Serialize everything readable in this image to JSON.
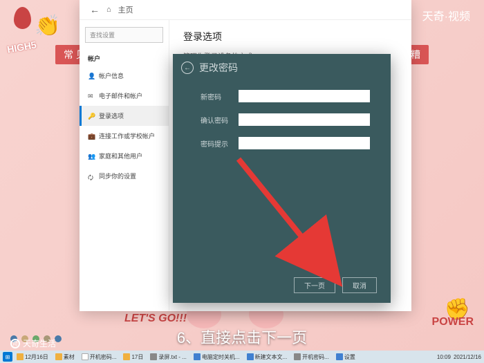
{
  "decorations": {
    "high5": "HIGH5",
    "tag1": "常 见",
    "tag2": "乱七八糟",
    "letsgo": "LET'S GO!!!",
    "power": "POWER"
  },
  "watermark": {
    "top_right": "天奇·视频",
    "bottom_left": "天奇生活"
  },
  "settings": {
    "header_home": "主页",
    "search_placeholder": "查找设置",
    "section": "帐户",
    "items": [
      {
        "label": "帐户信息"
      },
      {
        "label": "电子邮件和帐户"
      },
      {
        "label": "登录选项"
      },
      {
        "label": "连接工作或学校帐户"
      },
      {
        "label": "家庭和其他用户"
      },
      {
        "label": "同步你的设置"
      }
    ],
    "main_title": "登录选项",
    "main_sub": "管理你登录设备的方式"
  },
  "dialog": {
    "title": "更改密码",
    "fields": {
      "new_password": "新密码",
      "confirm_password": "确认密码",
      "hint": "密码提示"
    },
    "buttons": {
      "next": "下一页",
      "cancel": "取消"
    }
  },
  "subtitle": "6、直接点击下一页",
  "taskbar": {
    "items": [
      {
        "label": "12月16日"
      },
      {
        "label": "素材"
      },
      {
        "label": "开机密码..."
      },
      {
        "label": "17日"
      },
      {
        "label": "录屏.txt - ..."
      },
      {
        "label": "电脑定时关机..."
      },
      {
        "label": "新建文本文..."
      },
      {
        "label": "开机密码..."
      },
      {
        "label": "设置"
      }
    ],
    "time": "10:09",
    "date": "2021/12/16"
  }
}
